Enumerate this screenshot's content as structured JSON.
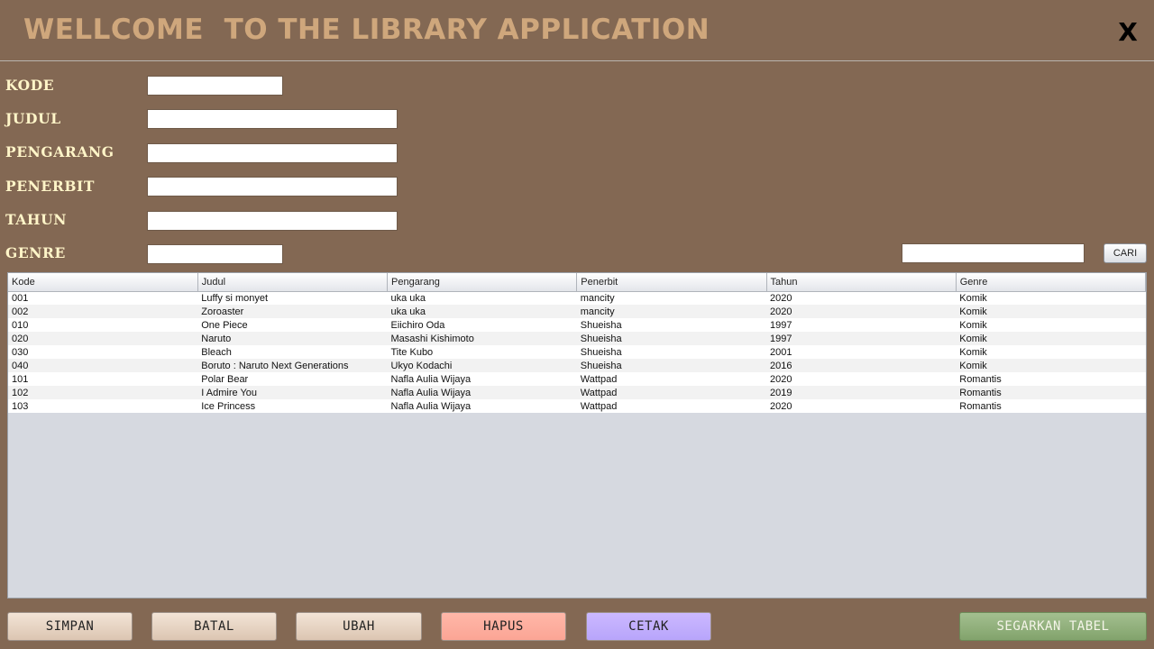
{
  "header": {
    "title": "WELLCOME  TO THE LIBRARY APPLICATION",
    "close_label": "X"
  },
  "form": {
    "kode_label": "KODE",
    "judul_label": "JUDUL",
    "pengarang_label": "PENGARANG",
    "penerbit_label": "PENERBIT",
    "tahun_label": "TAHUN",
    "genre_label": "GENRE",
    "kode_value": "",
    "judul_value": "",
    "pengarang_value": "",
    "penerbit_value": "",
    "tahun_value": "",
    "genre_value": ""
  },
  "search": {
    "value": "",
    "button_label": "CARI"
  },
  "table": {
    "columns": [
      "Kode",
      "Judul",
      "Pengarang",
      "Penerbit",
      "Tahun",
      "Genre"
    ],
    "rows": [
      [
        "001",
        "Luffy si monyet",
        "uka uka",
        "mancity",
        "2020",
        "Komik"
      ],
      [
        "002",
        "Zoroaster",
        "uka uka",
        "mancity",
        "2020",
        "Komik"
      ],
      [
        "010",
        "One Piece",
        "Eiichiro Oda",
        "Shueisha",
        "1997",
        "Komik"
      ],
      [
        "020",
        "Naruto",
        "Masashi Kishimoto",
        "Shueisha",
        "1997",
        "Komik"
      ],
      [
        "030",
        "Bleach",
        "Tite Kubo",
        "Shueisha",
        "2001",
        "Komik"
      ],
      [
        "040",
        "Boruto : Naruto Next Generations",
        "Ukyo Kodachi",
        "Shueisha",
        "2016",
        "Komik"
      ],
      [
        "101",
        "Polar Bear",
        "Nafla Aulia Wijaya",
        "Wattpad",
        "2020",
        "Romantis"
      ],
      [
        "102",
        "I Admire You",
        "Nafla Aulia Wijaya",
        "Wattpad",
        "2019",
        "Romantis"
      ],
      [
        "103",
        "Ice Princess",
        "Nafla Aulia Wijaya",
        "Wattpad",
        "2020",
        "Romantis"
      ]
    ]
  },
  "buttons": {
    "simpan": "SIMPAN",
    "batal": "BATAL",
    "ubah": "UBAH",
    "hapus": "HAPUS",
    "cetak": "CETAK",
    "refresh": "SEGARKAN TABEL"
  },
  "colors": {
    "background": "#836853",
    "title": "#cfa77c",
    "label": "#fff5c8",
    "hapus": "#fba595",
    "cetak": "#b8a5fb",
    "refresh": "#82a36c"
  }
}
